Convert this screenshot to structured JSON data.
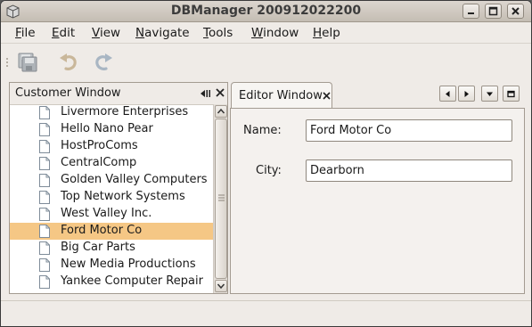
{
  "window": {
    "title": "DBManager 200912022200"
  },
  "menu": [
    {
      "label": "File",
      "mnemonic": "F",
      "rest": "ile"
    },
    {
      "label": "Edit",
      "mnemonic": "E",
      "rest": "dit"
    },
    {
      "label": "View",
      "mnemonic": "V",
      "rest": "iew"
    },
    {
      "label": "Navigate",
      "mnemonic": "N",
      "rest": "avigate"
    },
    {
      "label": "Tools",
      "mnemonic": "T",
      "rest": "ools"
    },
    {
      "label": "Window",
      "mnemonic": "W",
      "rest": "indow"
    },
    {
      "label": "Help",
      "mnemonic": "H",
      "rest": "elp"
    }
  ],
  "toolbar": {
    "buttons": [
      {
        "name": "save-icon",
        "enabled": false
      },
      {
        "name": "undo-icon",
        "enabled": false
      },
      {
        "name": "redo-icon",
        "enabled": false
      }
    ]
  },
  "customer_window": {
    "title": "Customer Window",
    "items": [
      "Livermore Enterprises",
      "Hello Nano Pear",
      "HostProComs",
      "CentralComp",
      "Golden Valley Computers",
      "Top Network Systems",
      "West Valley Inc.",
      "Ford Motor Co",
      "Big Car Parts",
      "New Media Productions",
      "Yankee Computer Repair"
    ],
    "selected_index": 7
  },
  "editor_window": {
    "tab_label": "Editor Window",
    "fields": {
      "name_label": "Name:",
      "name_value": "Ford Motor Co",
      "city_label": "City:",
      "city_value": "Dearborn"
    }
  },
  "colors": {
    "selection": "#f5c785",
    "window_bg": "#efebe7"
  }
}
